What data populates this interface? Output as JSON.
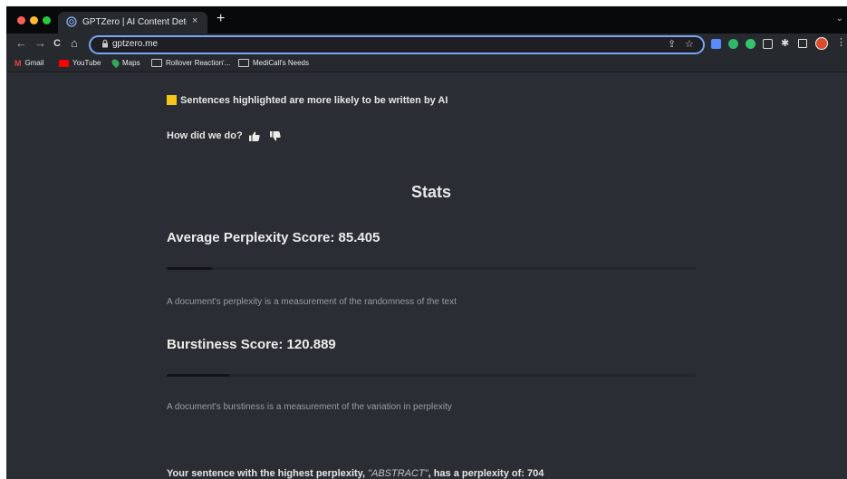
{
  "browser": {
    "tab_title": "GPTZero | AI Content Detector",
    "tab_close": "×",
    "new_tab": "+",
    "url": "gptzero.me",
    "nav": {
      "back": "←",
      "forward": "→",
      "reload": "C",
      "home": "⌂"
    },
    "window_menu_chevron": "⌄",
    "extensions": [
      {
        "name": "extension-1-icon",
        "color": "#5a8cff"
      },
      {
        "name": "extension-2-icon",
        "color": "#2fb86b"
      },
      {
        "name": "extension-3-icon",
        "color": "#35c36e"
      },
      {
        "name": "extension-4-icon",
        "color": "#d8d8d8"
      },
      {
        "name": "puzzle-icon",
        "color": "#e0e0e0"
      },
      {
        "name": "sidepanel-icon",
        "color": "#e0e0e0"
      },
      {
        "name": "avatar",
        "color": "#d94c2f"
      }
    ]
  },
  "bookmarks": [
    {
      "label": "Gmail",
      "icon": "gmail-icon"
    },
    {
      "label": "YouTube",
      "icon": "youtube-icon"
    },
    {
      "label": "Maps",
      "icon": "maps-icon"
    },
    {
      "label": "Rollover Reaction'...",
      "icon": "folder-icon"
    },
    {
      "label": "MediCall's Needs",
      "icon": "folder-icon"
    }
  ],
  "page": {
    "highlight_legend": "Sentences highlighted are more likely to be written by AI",
    "feedback_prompt": "How did we do?",
    "stats_title": "Stats",
    "perplexity": {
      "label": "Average Perplexity Score: 85.405",
      "bar_fraction": 0.085,
      "description": "A document's perplexity is a measurement of the randomness of the text"
    },
    "burstiness": {
      "label": "Burstiness Score: 120.889",
      "bar_fraction": 0.12,
      "description": "A document's burstiness is a measurement of the variation in perplexity"
    },
    "highest": {
      "prefix": "Your sentence with the highest perplexity, ",
      "sentence": "\"ABSTRACT\"",
      "suffix": ", has a perplexity of: 704"
    }
  },
  "colors": {
    "page_bg": "#2a2d33",
    "highlight": "#f5c518",
    "omnibox_focus": "#7aa5f5"
  }
}
